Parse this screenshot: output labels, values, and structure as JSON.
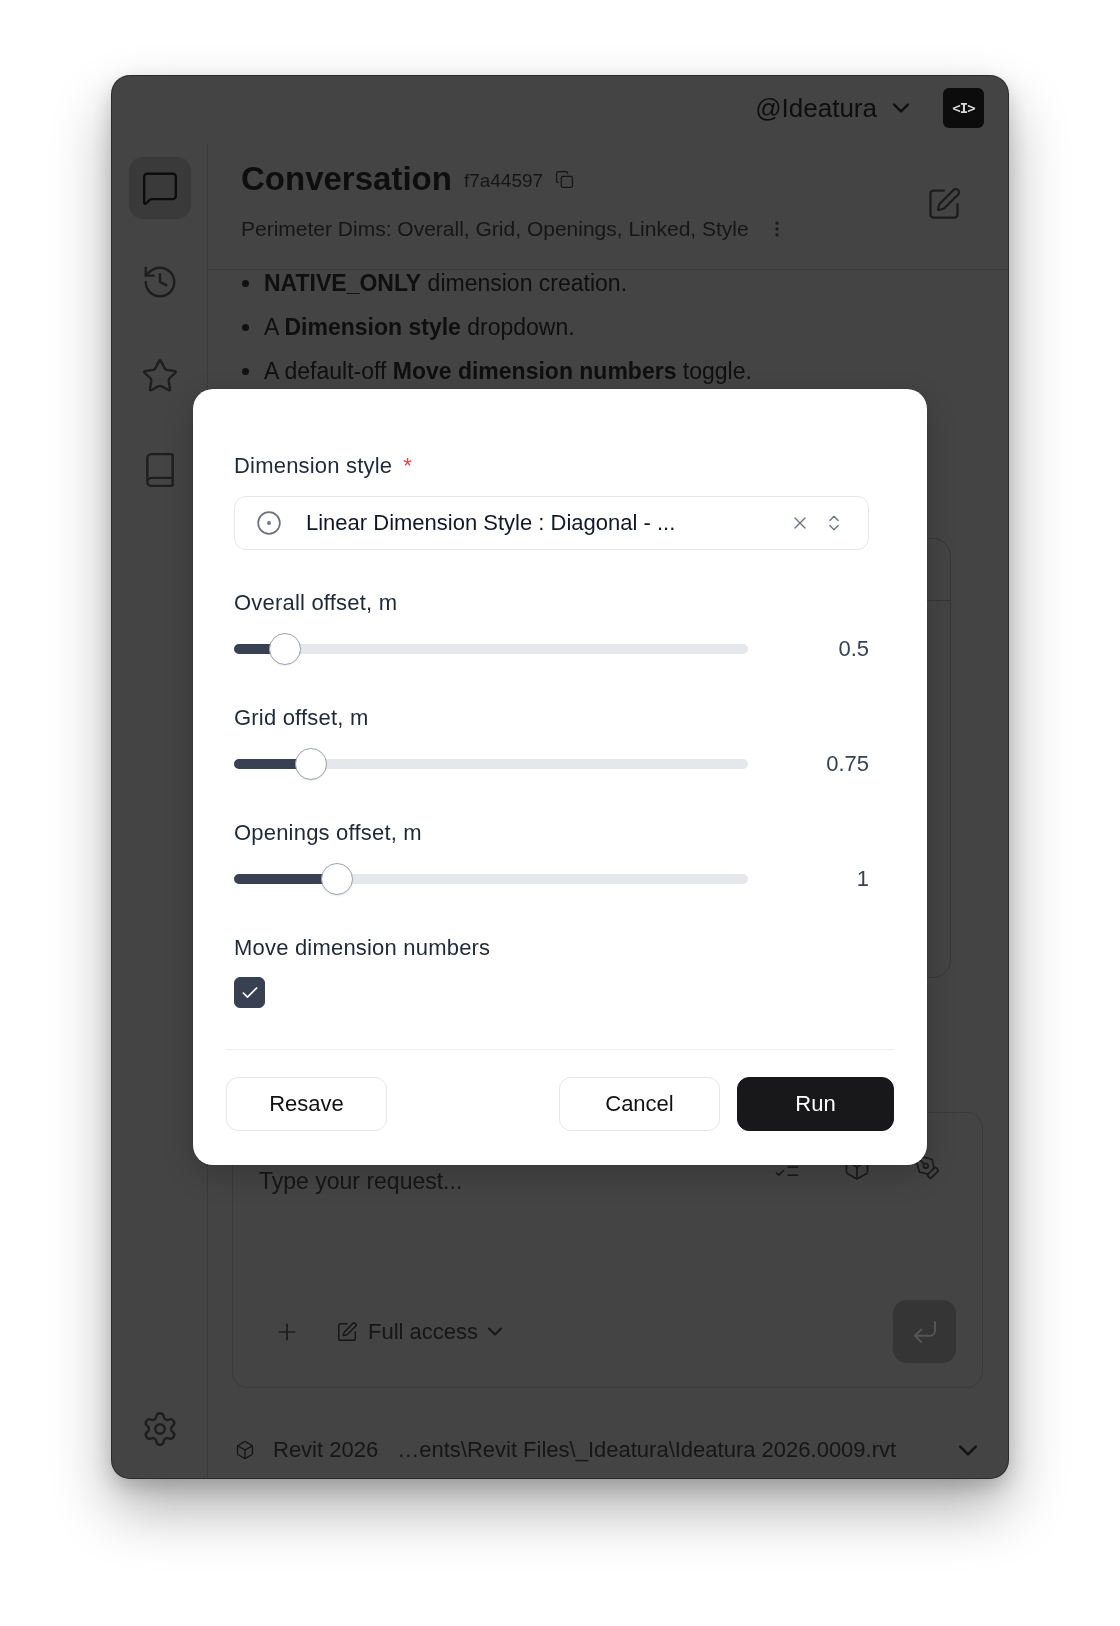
{
  "window": {
    "account": "@Ideatura",
    "logo_text": "<I>"
  },
  "sidebar": {
    "items": [
      {
        "kind": "chat",
        "selected": true
      },
      {
        "kind": "history",
        "selected": false
      },
      {
        "kind": "favorites",
        "selected": false
      },
      {
        "kind": "library",
        "selected": false
      }
    ]
  },
  "conversation": {
    "title": "Conversation",
    "id": "f7a44597",
    "subtitle": "Perimeter Dims: Overall, Grid, Openings, Linked, Style"
  },
  "messages": {
    "bullets": [
      "**NATIVE_ONLY** dimension creation.",
      "A **Dimension style** dropdown.",
      "A default-off **Move dimension numbers** toggle."
    ]
  },
  "composer": {
    "placeholder": "Type your request...",
    "access": "Full access"
  },
  "status_bar": {
    "app": "Revit 2026",
    "file": "…ents\\Revit Files\\_Ideatura\\Ideatura 2026.0009.rvt"
  },
  "dialog": {
    "fields": [
      {
        "kind": "select",
        "label": "Dimension style",
        "required_mark": "*",
        "value": "Linear Dimension Style : Diagonal - ..."
      },
      {
        "kind": "slider",
        "label": "Overall offset, m",
        "level": 0.1,
        "reading": "0.5"
      },
      {
        "kind": "slider",
        "label": "Grid offset, m",
        "level": 0.15,
        "reading": "0.75"
      },
      {
        "kind": "slider",
        "label": "Openings offset, m",
        "level": 0.2,
        "reading": "1"
      },
      {
        "kind": "checkbox",
        "label": "Move dimension numbers",
        "checked": true
      }
    ],
    "footer": {
      "start_buttons": [
        {
          "label": "Resave",
          "kind": "secondary"
        }
      ],
      "end_buttons": [
        {
          "label": "Cancel",
          "kind": "secondary"
        },
        {
          "label": "Run",
          "kind": "primary"
        }
      ]
    }
  }
}
